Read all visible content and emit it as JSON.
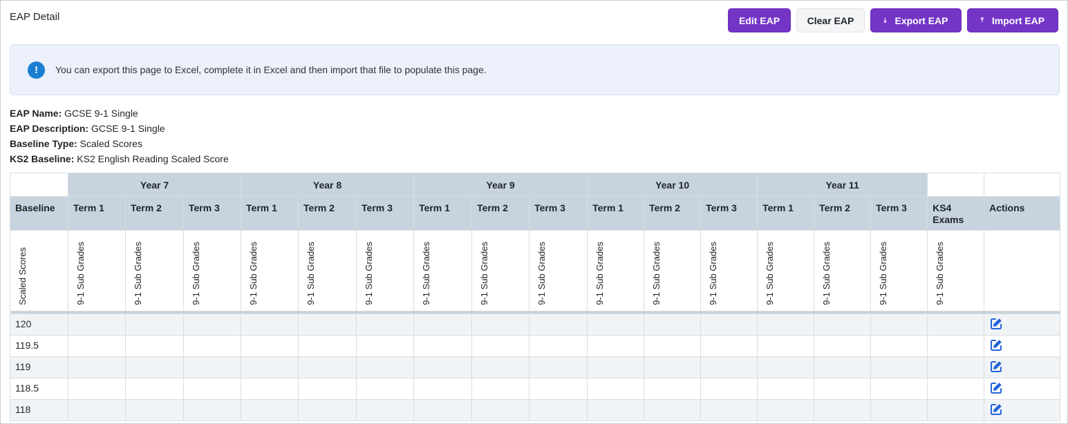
{
  "page": {
    "title": "EAP Detail"
  },
  "toolbar": {
    "edit_label": "Edit EAP",
    "clear_label": "Clear EAP",
    "export_label": "Export EAP",
    "import_label": "Import EAP",
    "export_icon": "download-icon",
    "import_icon": "upload-icon"
  },
  "info": {
    "icon": "exclamation-icon",
    "text": "You can export this page to Excel, complete it in Excel and then import that file to populate this page."
  },
  "meta": [
    {
      "label": "EAP Name:",
      "value": "GCSE 9-1 Single"
    },
    {
      "label": "EAP Description:",
      "value": "GCSE 9-1 Single"
    },
    {
      "label": "Baseline Type:",
      "value": "Scaled Scores"
    },
    {
      "label": "KS2 Baseline:",
      "value": "KS2 English Reading Scaled Score"
    }
  ],
  "grid": {
    "years": [
      "Year 7",
      "Year 8",
      "Year 9",
      "Year 10",
      "Year 11"
    ],
    "baseline_header": "Baseline",
    "terms": [
      "Term 1",
      "Term 2",
      "Term 3"
    ],
    "ks4_header": "KS4 Exams",
    "actions_header": "Actions",
    "baseline_sub": "Scaled Scores",
    "grade_sub": "9-1 Sub Grades",
    "rows": [
      "120",
      "119.5",
      "119",
      "118.5",
      "118"
    ],
    "colors": {
      "header_bg": "#c7d4df",
      "stripe_bg": "#f1f4f7",
      "edit_icon": "#2563d9"
    }
  }
}
